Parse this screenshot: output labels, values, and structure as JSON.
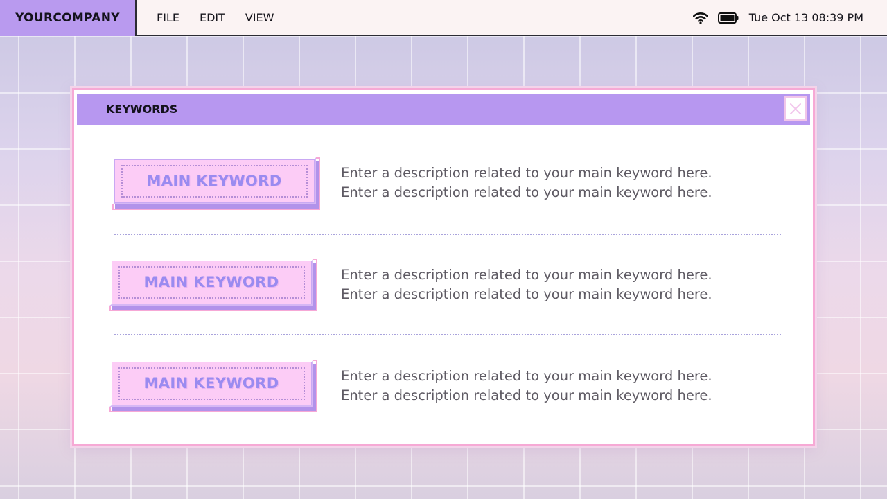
{
  "menubar": {
    "brand": "YOURCOMPANY",
    "menus": [
      "FILE",
      "EDIT",
      "VIEW"
    ],
    "datetime": "Tue Oct 13 08:39 PM"
  },
  "window": {
    "title": "KEYWORDS",
    "rows": [
      {
        "keyword": "MAIN KEYWORD",
        "line1": "Enter a description related to your main keyword here.",
        "line2": "Enter a description related to your main keyword here."
      },
      {
        "keyword": "MAIN KEYWORD",
        "line1": "Enter a description related to your main keyword here.",
        "line2": "Enter a description related to your main keyword here."
      },
      {
        "keyword": "MAIN KEYWORD",
        "line1": "Enter a description related to your main keyword here.",
        "line2": "Enter a description related to your main keyword here."
      }
    ]
  },
  "icons": {
    "wifi": "wifi-icon",
    "battery": "battery-icon",
    "close": "close-icon"
  },
  "colors": {
    "brand_bg": "#b99aef",
    "titlebar_bg": "#b797f0",
    "window_border": "#f6a9d5",
    "keyword_fill": "#fcccf6",
    "keyword_text": "#9a8bf0"
  }
}
